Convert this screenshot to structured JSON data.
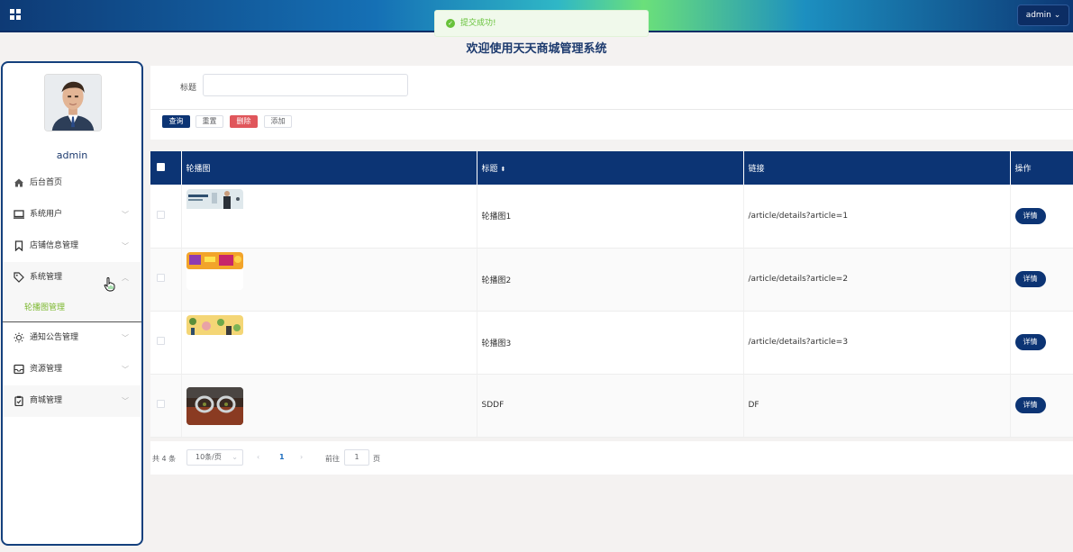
{
  "header": {
    "user_menu": "admin ⌄"
  },
  "toast": {
    "message": "提交成功!"
  },
  "page_title": "欢迎使用天天商城管理系统",
  "sidebar": {
    "username": "admin",
    "items": [
      {
        "label": "后台首页",
        "icon": "home-icon"
      },
      {
        "label": "系统用户",
        "icon": "monitor-icon"
      },
      {
        "label": "店铺信息管理",
        "icon": "bookmark-icon"
      },
      {
        "label": "系统管理",
        "icon": "tag-icon"
      },
      {
        "label": "通知公告管理",
        "icon": "sun-icon"
      },
      {
        "label": "资源管理",
        "icon": "inbox-icon"
      },
      {
        "label": "商城管理",
        "icon": "clipboard-icon"
      }
    ],
    "sub_item": "轮播图管理"
  },
  "search": {
    "label": "标题",
    "value": "",
    "buttons": {
      "query": "查询",
      "reset": "重置",
      "delete": "删除",
      "add": "添加"
    }
  },
  "table": {
    "columns": [
      "轮播图",
      "标题",
      "链接",
      "操作"
    ],
    "rows": [
      {
        "title": "轮播图1",
        "link": "/article/details?article=1",
        "action": "详情"
      },
      {
        "title": "轮播图2",
        "link": "/article/details?article=2",
        "action": "详情"
      },
      {
        "title": "轮播图3",
        "link": "/article/details?article=3",
        "action": "详情"
      },
      {
        "title": "SDDF",
        "link": "DF",
        "action": "详情"
      }
    ]
  },
  "pagination": {
    "total": "共 4 条",
    "page_size": "10条/页",
    "current_page": "1",
    "goto_label": "前往",
    "goto_value": "1",
    "page_unit": "页"
  },
  "colors": {
    "primary": "#0c3474",
    "danger": "#e0565b",
    "success": "#67c23a",
    "submenu_active": "#7cb82f"
  }
}
